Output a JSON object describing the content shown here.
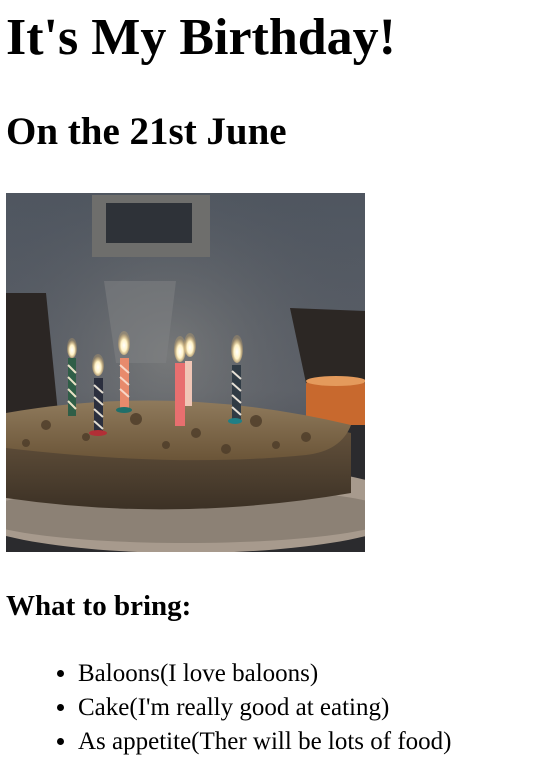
{
  "page": {
    "title": "It's My Birthday!",
    "subtitle": "On the 21st June"
  },
  "photo": {
    "icon": "birthday-cake-with-candles"
  },
  "bring": {
    "heading": "What to bring:",
    "items": [
      "Baloons(I love baloons)",
      "Cake(I'm really good at eating)",
      "As appetite(Ther will be lots of food)"
    ]
  }
}
